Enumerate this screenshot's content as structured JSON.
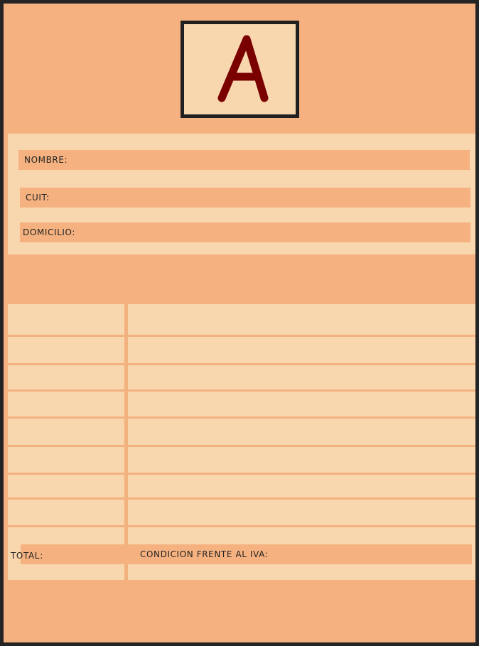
{
  "stamp": {
    "letter": "A",
    "letter_color": "#7a0000"
  },
  "fields": {
    "nombre": "NOMBRE:",
    "cuit": "CUIT:",
    "domicilio": "DOMICILIO:"
  },
  "footer": {
    "total": "TOTAL:",
    "condicion_iva": "CONDICION FRENTE AL IVA:"
  },
  "colors": {
    "primary": "#f5b280",
    "secondary": "#f8d6ae",
    "border": "#242424"
  }
}
